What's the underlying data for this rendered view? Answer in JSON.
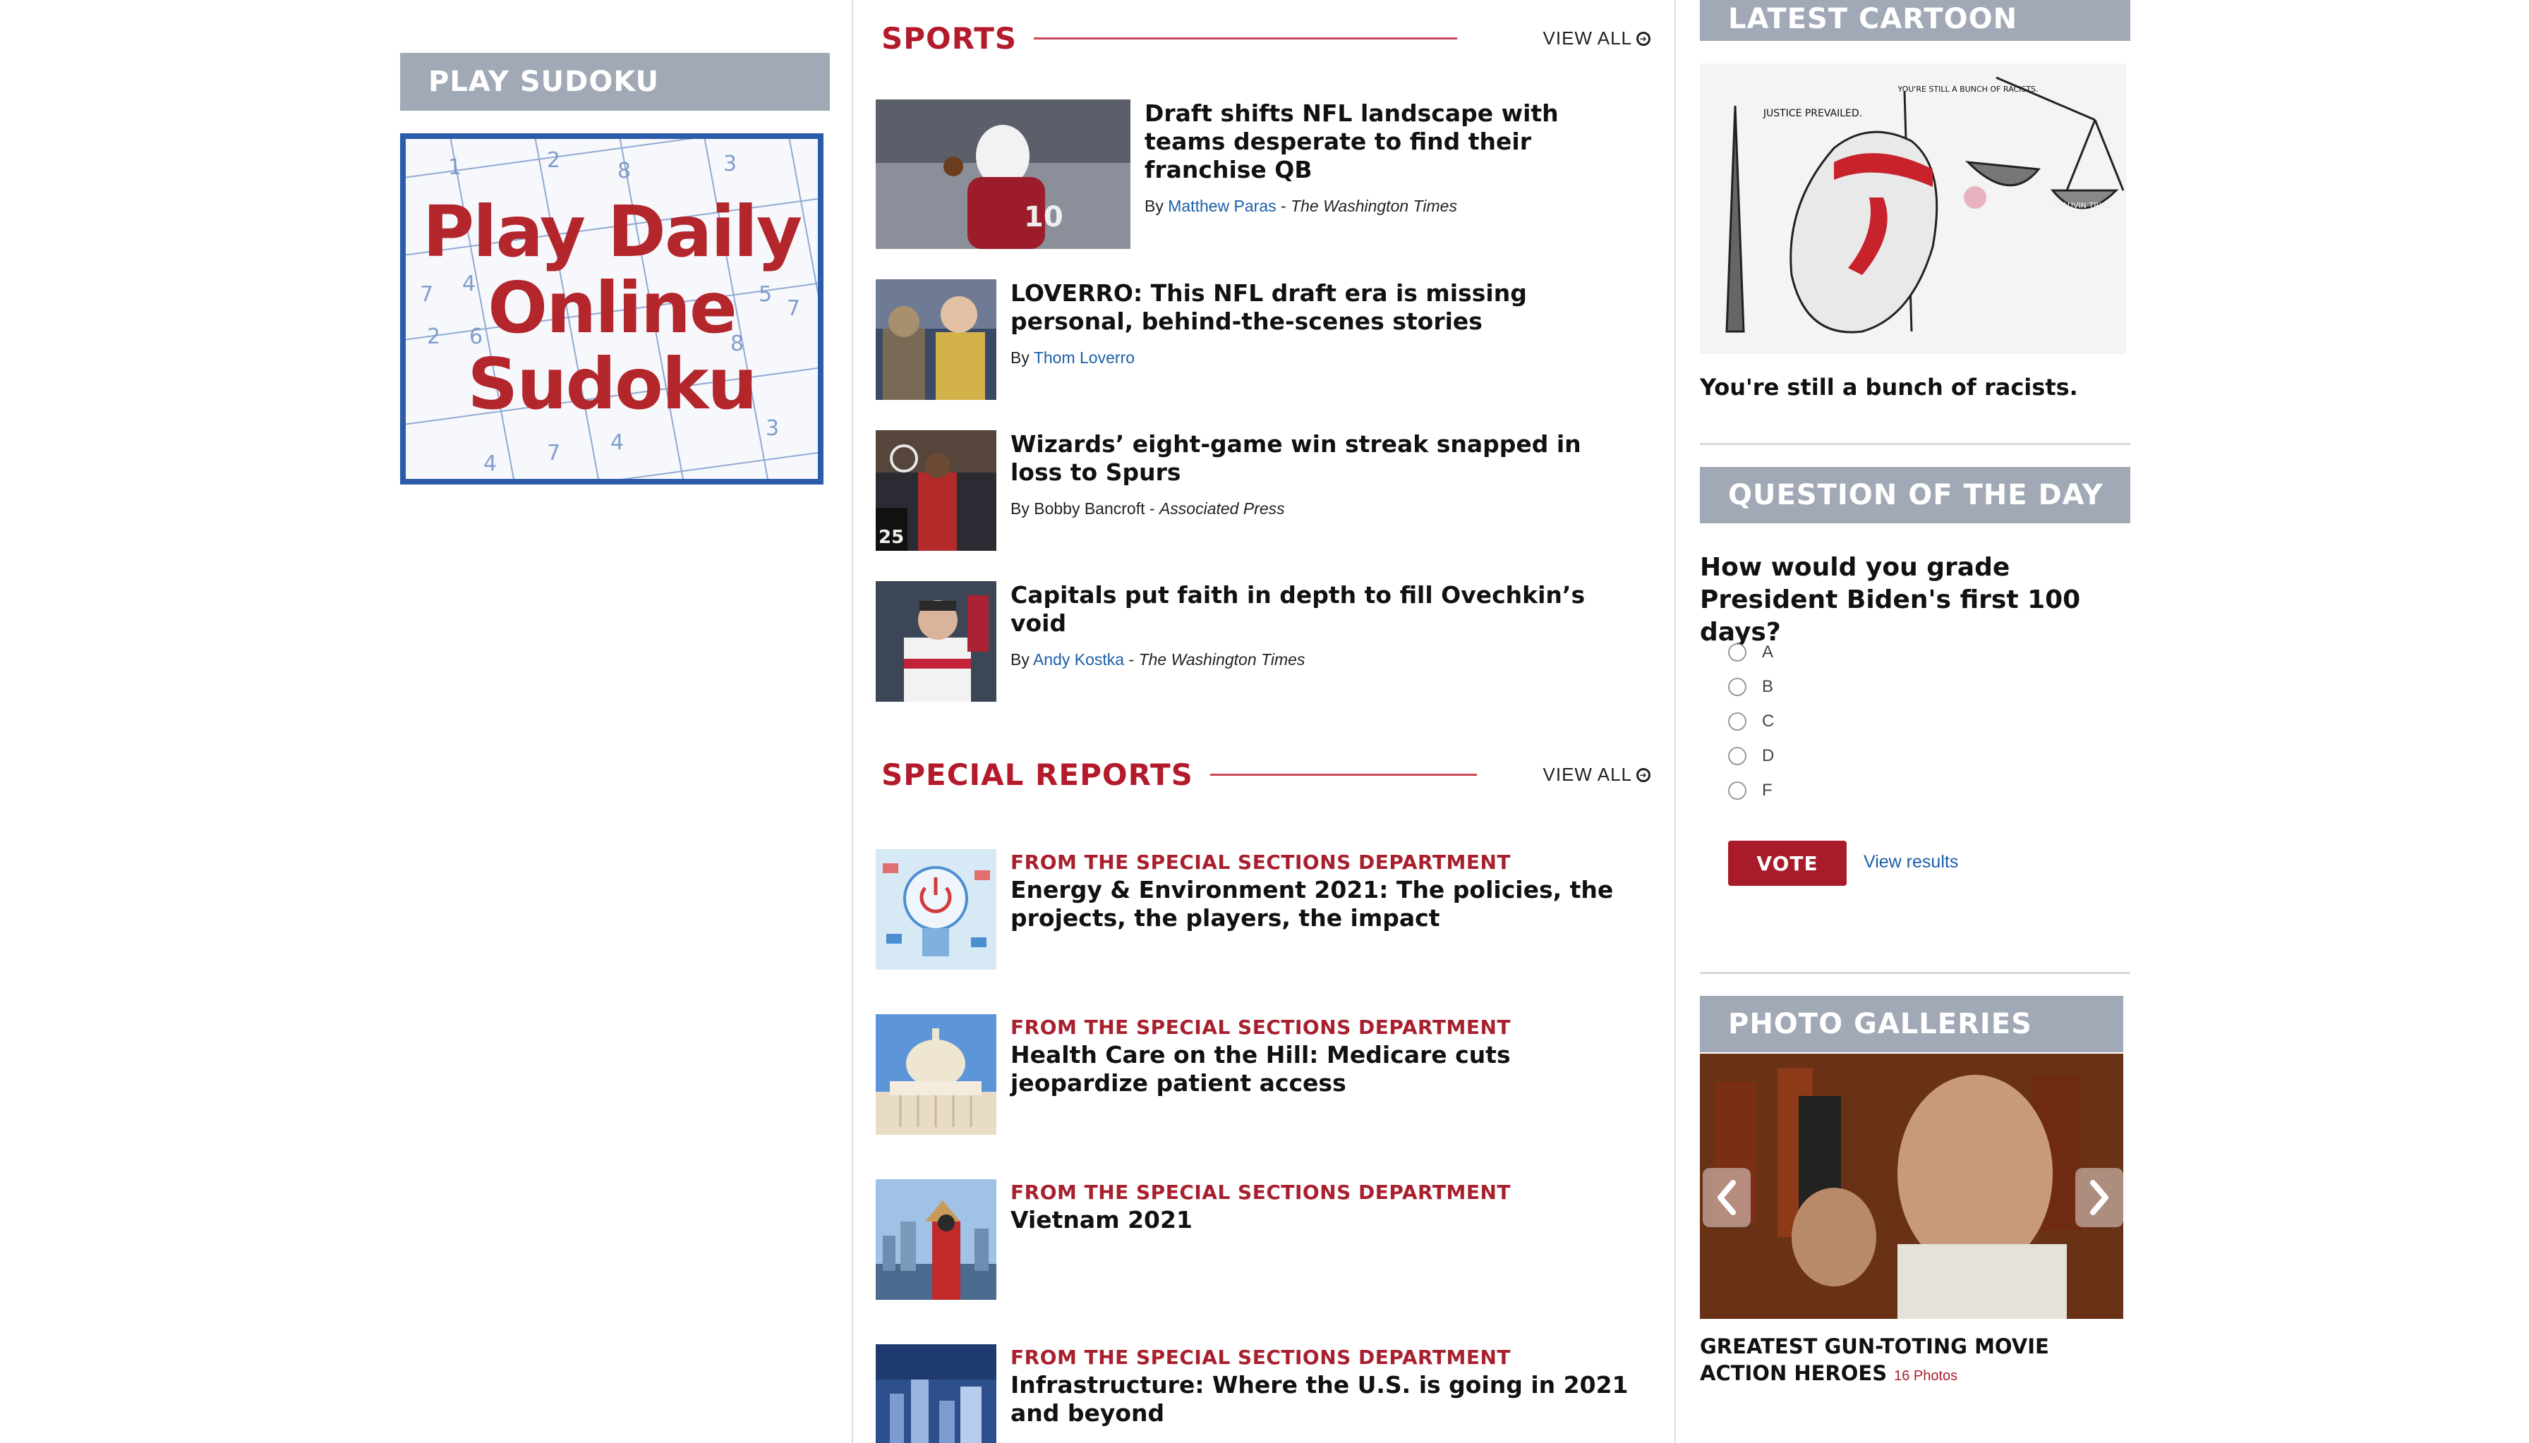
{
  "colors": {
    "accent_red": "#b31b2c",
    "header_gray": "#a1a8b6",
    "link_blue": "#1a5fa8",
    "sudoku_border_blue": "#2a5caa"
  },
  "left": {
    "sudoku_header": "PLAY SUDOKU",
    "sudoku_promo_lines": [
      "Play Daily",
      "Online",
      "Sudoku"
    ]
  },
  "sports": {
    "title": "SPORTS",
    "view_all": "VIEW ALL",
    "stories": [
      {
        "headline": "Draft shifts NFL landscape with teams desperate to find their franchise QB",
        "by": "By",
        "author": "Matthew Paras",
        "sep": " - ",
        "publication": "The Washington Times"
      },
      {
        "headline": "LOVERRO: This NFL draft era is missing personal, behind-the-scenes stories",
        "by": "By",
        "author": "Thom Loverro",
        "sep": "",
        "publication": ""
      },
      {
        "headline": "Wizards’ eight-game win streak snapped in loss to Spurs",
        "by": "By Bobby Bancroft",
        "author": "",
        "sep": " - ",
        "publication": "Associated Press"
      },
      {
        "headline": "Capitals put faith in depth to fill Ovechkin’s void",
        "by": "By",
        "author": "Andy Kostka",
        "sep": " - ",
        "publication": "The Washington Times"
      }
    ]
  },
  "special_reports": {
    "title": "SPECIAL REPORTS",
    "view_all": "VIEW ALL",
    "items": [
      {
        "dept": "FROM THE SPECIAL SECTIONS DEPARTMENT",
        "headline": "Energy & Environment 2021: The policies, the projects, the players, the impact"
      },
      {
        "dept": "FROM THE SPECIAL SECTIONS DEPARTMENT",
        "headline": "Health Care on the Hill: Medicare cuts jeopardize patient access"
      },
      {
        "dept": "FROM THE SPECIAL SECTIONS DEPARTMENT",
        "headline": "Vietnam 2021"
      },
      {
        "dept": "FROM THE SPECIAL SECTIONS DEPARTMENT",
        "headline": "Infrastructure: Where the U.S. is going in 2021 and beyond"
      }
    ]
  },
  "cartoon": {
    "header": "LATEST CARTOON",
    "caption": "You're still a bunch of racists.",
    "drawn_labels": [
      "JUSTICE PREVAILED.",
      "YOU'RE STILL A BUNCH OF RACISTS.",
      "CHAUVIN TRIAL"
    ]
  },
  "poll": {
    "header": "QUESTION OF THE DAY",
    "question": "How would you grade President Biden's first 100 days?",
    "options": [
      "A",
      "B",
      "C",
      "D",
      "F"
    ],
    "vote_label": "VOTE",
    "view_results": "View results"
  },
  "gallery": {
    "header": "PHOTO GALLERIES",
    "caption": "GREATEST GUN-TOTING MOVIE ACTION HEROES",
    "photo_count": "16 Photos"
  }
}
